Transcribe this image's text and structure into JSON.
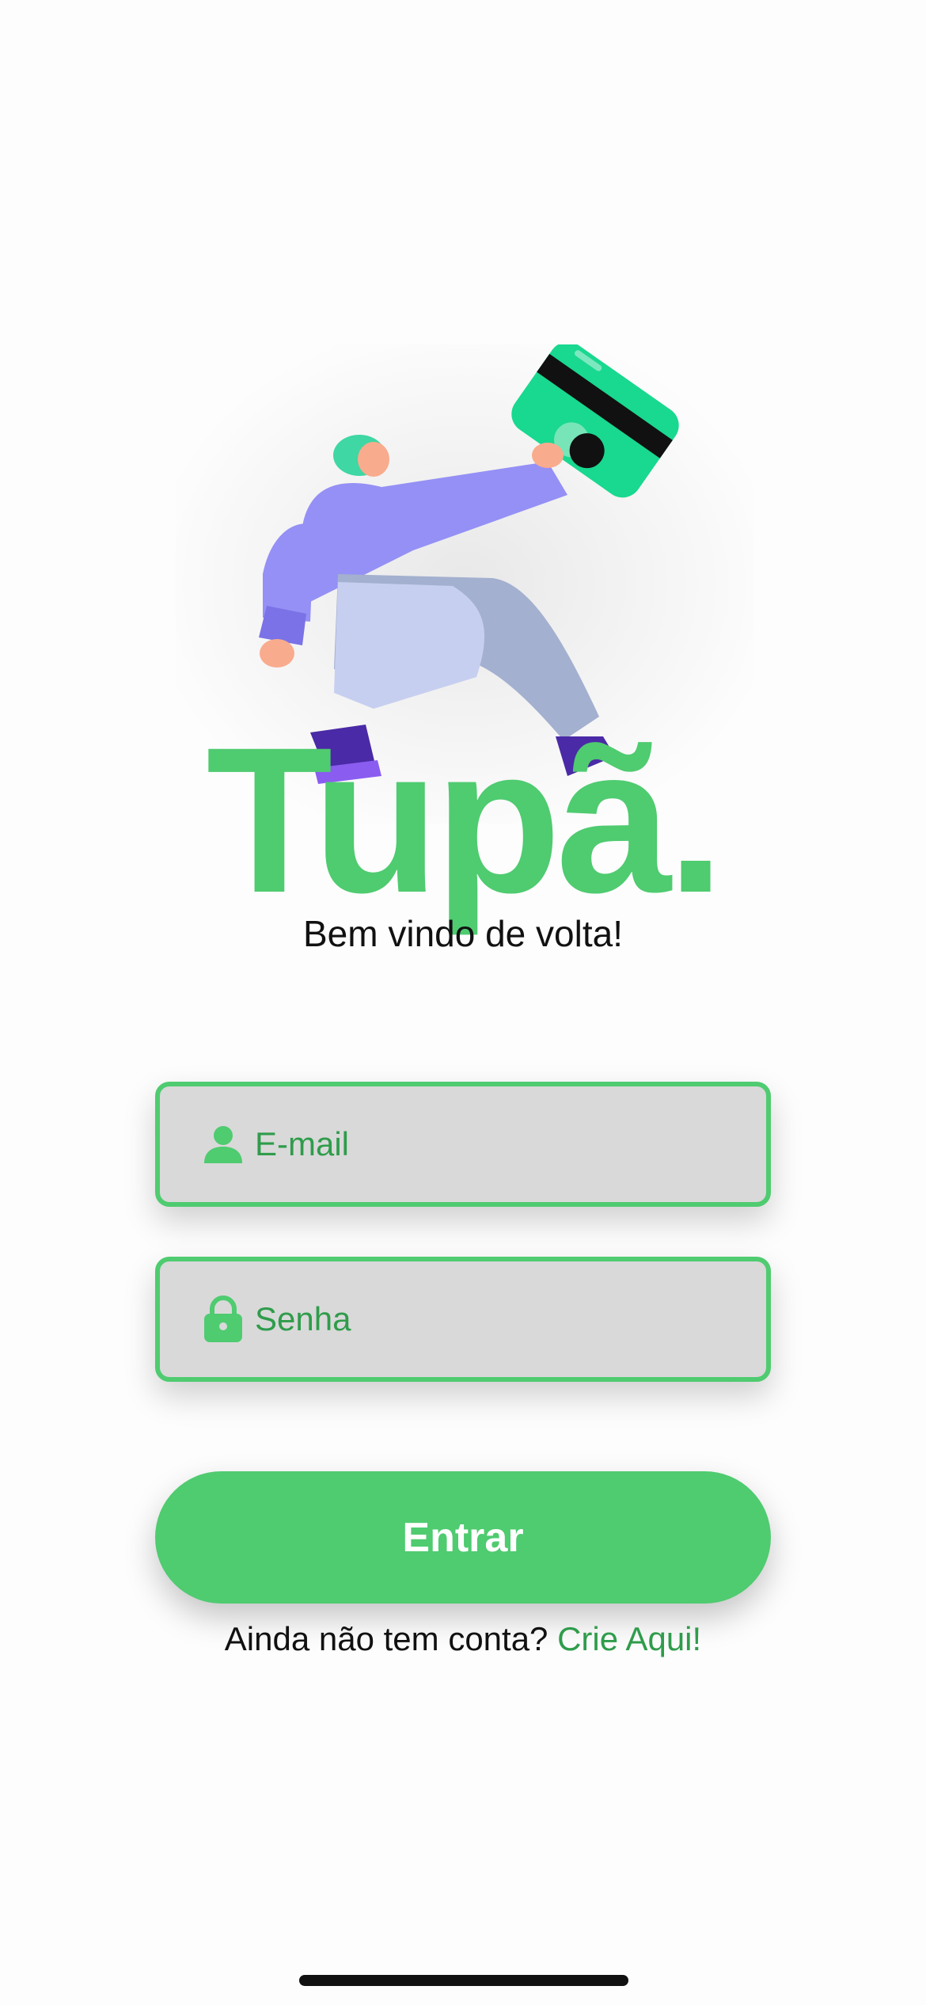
{
  "app": {
    "brand": "Tupã.",
    "welcome": "Bem vindo de volta!"
  },
  "form": {
    "email": {
      "placeholder": "E-mail",
      "value": "",
      "icon": "user-icon"
    },
    "password": {
      "placeholder": "Senha",
      "value": "",
      "icon": "lock-icon"
    },
    "submit_label": "Entrar"
  },
  "signup": {
    "prompt": "Ainda não tem conta?",
    "link_label": "Crie Aqui!"
  },
  "colors": {
    "accent": "#4fcb70",
    "accent_text": "#2f9c4b",
    "field_bg": "#d9d9d9",
    "illustration_purple": "#9590f5",
    "illustration_card": "#19d88f"
  }
}
